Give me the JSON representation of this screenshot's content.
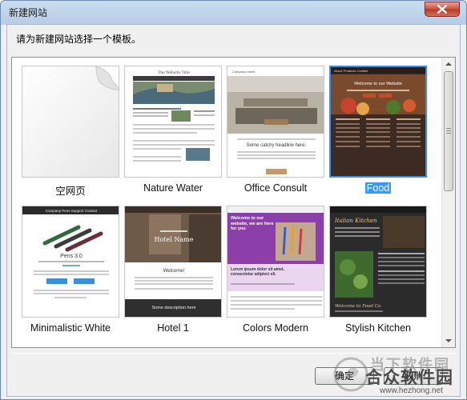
{
  "window": {
    "title": "新建网站"
  },
  "prompt": "请为新建网站选择一个模板。",
  "templates": [
    {
      "label": "空网页",
      "selected": false
    },
    {
      "label": "Nature Water",
      "selected": false
    },
    {
      "label": "Office Consult",
      "selected": false
    },
    {
      "label": "Food",
      "selected": true
    },
    {
      "label": "Minimalistic White",
      "selected": false
    },
    {
      "label": "Hotel 1",
      "selected": false
    },
    {
      "label": "Colors Modern",
      "selected": false
    },
    {
      "label": "Stylish Kitchen",
      "selected": false
    }
  ],
  "thumbs": {
    "nature_title": "The Website Title",
    "nature_heading": "Another cool title here",
    "office_company": "Company name",
    "office_headline": "Some catchy headline here.",
    "food_nav": "About  Products  Contact",
    "food_welcome": "Welcome to our Website",
    "minimal_nav": "Company  Pens  Support  Contact",
    "minimal_heading": "Pens 3.0",
    "hotel_name": "Hotel Name",
    "hotel_welcome": "Welcome!",
    "hotel_desc": "Some description here",
    "colors_heading": "Welcome to our website, we are here for you",
    "colors_sub": "Lorem ipsum dolor sit amet, consectetur adipisci eli.",
    "kitchen_name": "Italian Kitchen",
    "kitchen_welcome": "Welcome to Food Co."
  },
  "buttons": {
    "ok": "确定",
    "cancel": "取消"
  },
  "watermark": {
    "line1": "当下软件园",
    "line2": "合众软件园",
    "url": "www.hezhong.net"
  },
  "colors": {
    "accent": "#3399ff",
    "close": "#c9513b"
  }
}
